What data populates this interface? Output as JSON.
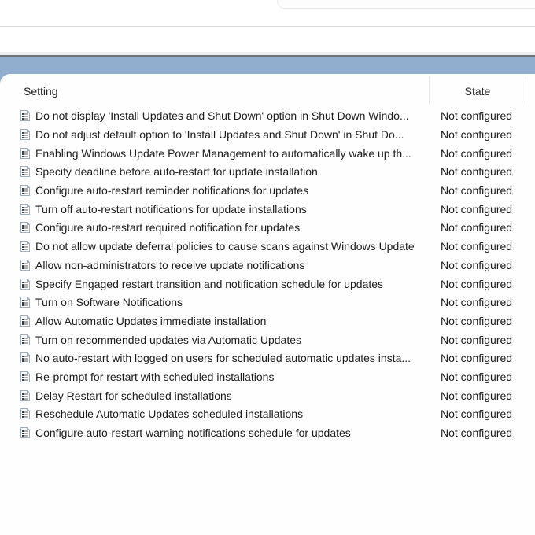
{
  "header": {
    "setting_col": "Setting",
    "state_col": "State"
  },
  "rows": [
    {
      "setting": "Do not display 'Install Updates and Shut Down' option in Shut Down Windo...",
      "state": "Not configured"
    },
    {
      "setting": "Do not adjust default option to 'Install Updates and Shut Down' in Shut Do...",
      "state": "Not configured"
    },
    {
      "setting": "Enabling Windows Update Power Management to automatically wake up th...",
      "state": "Not configured"
    },
    {
      "setting": "Specify deadline before auto-restart for update installation",
      "state": "Not configured"
    },
    {
      "setting": "Configure auto-restart reminder notifications for updates",
      "state": "Not configured"
    },
    {
      "setting": "Turn off auto-restart notifications for update installations",
      "state": "Not configured"
    },
    {
      "setting": "Configure auto-restart required notification for updates",
      "state": "Not configured"
    },
    {
      "setting": "Do not allow update deferral policies to cause scans against Windows Update",
      "state": "Not configured"
    },
    {
      "setting": "Allow non-administrators to receive update notifications",
      "state": "Not configured"
    },
    {
      "setting": "Specify Engaged restart transition and notification schedule for updates",
      "state": "Not configured"
    },
    {
      "setting": "Turn on Software Notifications",
      "state": "Not configured"
    },
    {
      "setting": "Allow Automatic Updates immediate installation",
      "state": "Not configured"
    },
    {
      "setting": "Turn on recommended updates via Automatic Updates",
      "state": "Not configured"
    },
    {
      "setting": "No auto-restart with logged on users for scheduled automatic updates insta...",
      "state": "Not configured"
    },
    {
      "setting": "Re-prompt for restart with scheduled installations",
      "state": "Not configured"
    },
    {
      "setting": "Delay Restart for scheduled installations",
      "state": "Not configured"
    },
    {
      "setting": "Reschedule Automatic Updates scheduled installations",
      "state": "Not configured"
    },
    {
      "setting": "Configure auto-restart warning notifications schedule for updates",
      "state": "Not configured"
    }
  ],
  "icons": {
    "row_icon": "policy-setting-icon"
  },
  "colors": {
    "header_band": "#91aecf",
    "band_top_line": "#6e7276",
    "top_divider": "#d9dadb",
    "column_separator": "#e5e6e7",
    "text": "#1c1c1c"
  }
}
